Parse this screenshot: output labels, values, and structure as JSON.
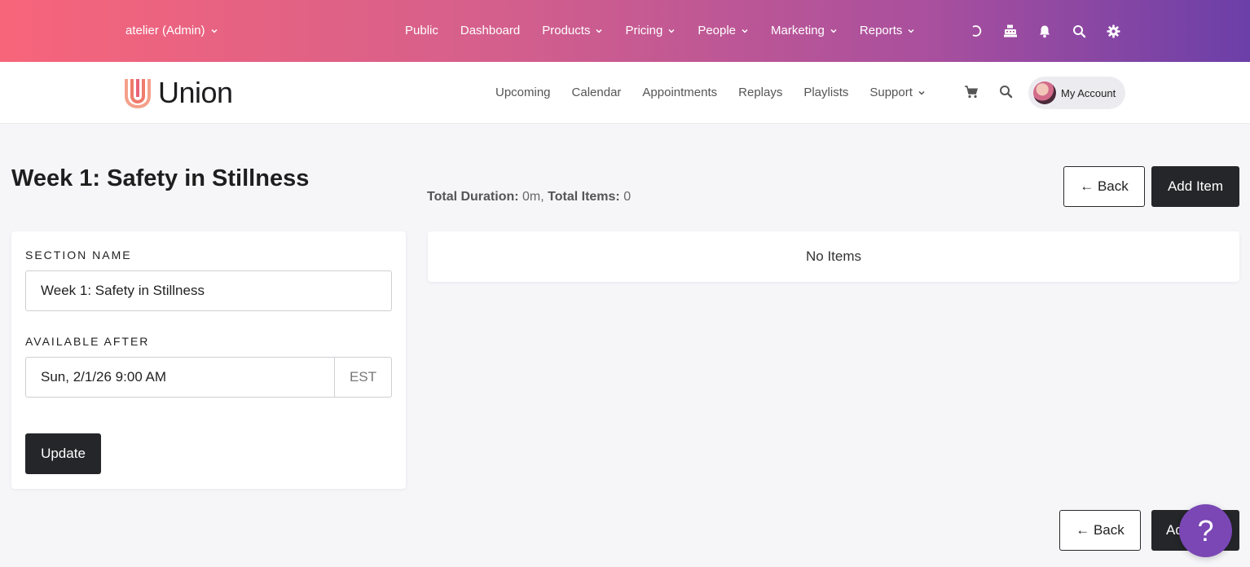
{
  "admin_bar": {
    "site_switcher": "atelier (Admin)",
    "nav": [
      {
        "label": "Public",
        "dropdown": false
      },
      {
        "label": "Dashboard",
        "dropdown": false
      },
      {
        "label": "Products",
        "dropdown": true
      },
      {
        "label": "Pricing",
        "dropdown": true
      },
      {
        "label": "People",
        "dropdown": true
      },
      {
        "label": "Marketing",
        "dropdown": true
      },
      {
        "label": "Reports",
        "dropdown": true
      }
    ],
    "icons": [
      "refresh-icon",
      "cash-register-icon",
      "bell-icon",
      "search-icon",
      "gear-icon"
    ]
  },
  "site_header": {
    "logo_text": "Union",
    "nav": [
      {
        "label": "Upcoming"
      },
      {
        "label": "Calendar"
      },
      {
        "label": "Appointments"
      },
      {
        "label": "Replays"
      },
      {
        "label": "Playlists"
      },
      {
        "label": "Support"
      }
    ],
    "account_label": "My Account"
  },
  "page": {
    "title": "Week 1: Safety in Stillness",
    "totals": {
      "duration_label": "Total Duration:",
      "duration_value": " 0m, ",
      "items_label": "Total Items:",
      "items_value": " 0"
    },
    "back_label": "← Back",
    "add_item_label": "Add Item",
    "add_item_bottom_label": "Ad"
  },
  "section_form": {
    "name_label": "SECTION NAME",
    "name_value": "Week 1: Safety in Stillness",
    "available_label": "AVAILABLE AFTER",
    "available_value": "Sun, 2/1/26 9:00 AM",
    "timezone": "EST",
    "update_label": "Update"
  },
  "items_panel": {
    "empty_text": "No Items"
  },
  "help": {
    "label": "?"
  },
  "colors": {
    "admin_gradient_start": "#f7657a",
    "admin_gradient_end": "#6b3fa8",
    "dark_button": "#25262a",
    "help_button": "#7a47b5"
  }
}
